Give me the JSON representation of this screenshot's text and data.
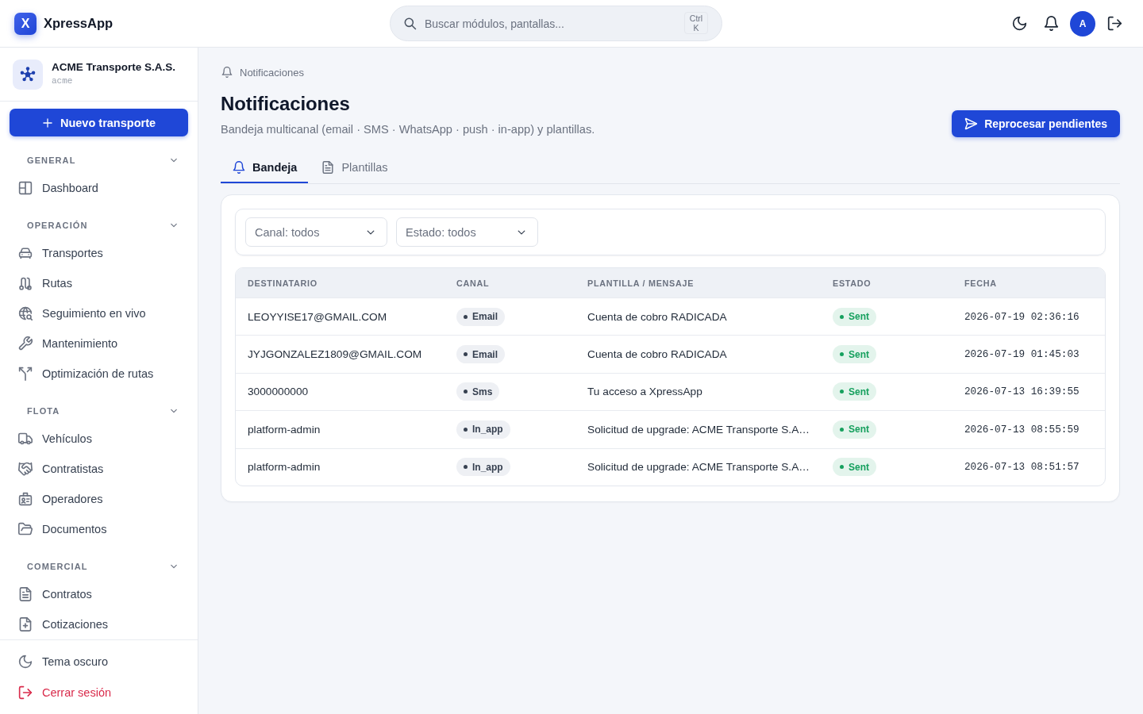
{
  "topbar": {
    "brand": {
      "mark": "X",
      "name": "XpressApp"
    },
    "search": {
      "placeholder": "Buscar módulos, pantallas...",
      "shortcut": "Ctrl K"
    },
    "avatar": "A"
  },
  "sidebar": {
    "org": {
      "name": "ACME Transporte S.A.S.",
      "slug": "acme"
    },
    "new_button": "Nuevo transporte",
    "sections": [
      {
        "title": "GENERAL",
        "expanded": true,
        "items": [
          {
            "label": "Dashboard",
            "selected": false
          }
        ]
      },
      {
        "title": "OPERACIÓN",
        "expanded": true,
        "items": [
          {
            "label": "Transportes",
            "selected": false
          },
          {
            "label": "Rutas",
            "selected": false
          },
          {
            "label": "Seguimiento en vivo",
            "selected": false
          },
          {
            "label": "Mantenimiento",
            "selected": false
          },
          {
            "label": "Optimización de rutas",
            "selected": false
          }
        ]
      },
      {
        "title": "FLOTA",
        "expanded": true,
        "items": [
          {
            "label": "Vehículos",
            "selected": false
          },
          {
            "label": "Contratistas",
            "selected": false
          },
          {
            "label": "Operadores",
            "selected": false
          },
          {
            "label": "Documentos",
            "selected": false
          }
        ]
      },
      {
        "title": "COMERCIAL",
        "expanded": true,
        "items": [
          {
            "label": "Contratos",
            "selected": false
          },
          {
            "label": "Cotizaciones",
            "selected": false
          }
        ]
      }
    ],
    "footer": [
      {
        "label": "Tema oscuro",
        "kind": "theme"
      },
      {
        "label": "Cerrar sesión",
        "kind": "logout"
      }
    ]
  },
  "page": {
    "breadcrumb": "Notificaciones",
    "title": "Notificaciones",
    "subtitle": "Bandeja multicanal (email · SMS · WhatsApp · push · in-app) y plantillas.",
    "primary_action": "Reprocesar pendientes",
    "tabs": [
      {
        "label": "Bandeja",
        "selected": true
      },
      {
        "label": "Plantillas",
        "selected": false
      }
    ],
    "filters": [
      {
        "value": "Canal: todos"
      },
      {
        "value": "Estado: todos"
      }
    ],
    "table": {
      "columns": [
        "DESTINATARIO",
        "CANAL",
        "PLANTILLA / MENSAJE",
        "ESTADO",
        "FECHA"
      ],
      "rows": [
        {
          "recipient": "LEOYYISE17@GMAIL.COM",
          "channel": "Email",
          "message": "Cuenta de cobro RADICADA",
          "status": {
            "label": "Sent",
            "color": "#16a05e"
          },
          "date": "2026-07-19 02:36:16"
        },
        {
          "recipient": "JYJGONZALEZ1809@GMAIL.COM",
          "channel": "Email",
          "message": "Cuenta de cobro RADICADA",
          "status": {
            "label": "Sent",
            "color": "#16a05e"
          },
          "date": "2026-07-19 01:45:03"
        },
        {
          "recipient": "3000000000",
          "channel": "Sms",
          "message": "Tu acceso a XpressApp",
          "status": {
            "label": "Sent",
            "color": "#16a05e"
          },
          "date": "2026-07-13 16:39:55"
        },
        {
          "recipient": "platform-admin",
          "channel": "In_app",
          "message": "Solicitud de upgrade: ACME Transporte S.A…",
          "status": {
            "label": "Sent",
            "color": "#16a05e"
          },
          "date": "2026-07-13 08:55:59"
        },
        {
          "recipient": "platform-admin",
          "channel": "In_app",
          "message": "Solicitud de upgrade: ACME Transporte S.A…",
          "status": {
            "label": "Sent",
            "color": "#16a05e"
          },
          "date": "2026-07-13 08:51:57"
        }
      ]
    }
  }
}
